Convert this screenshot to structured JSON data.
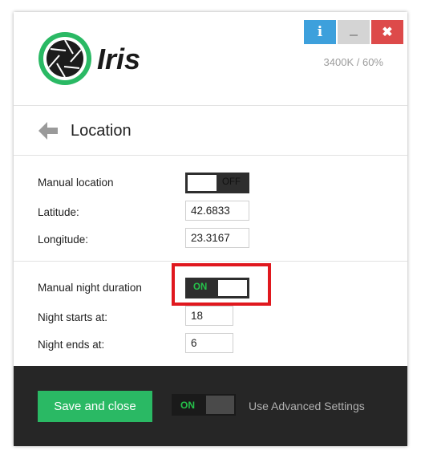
{
  "app": {
    "name": "Iris",
    "status": "3400K / 60%"
  },
  "window_buttons": {
    "info_label": "i",
    "minimize_label": "",
    "close_label": "✖"
  },
  "section": {
    "title": "Location"
  },
  "location": {
    "manual_location_label": "Manual location",
    "manual_location_state": "OFF",
    "latitude_label": "Latitude:",
    "latitude_value": "42.6833",
    "longitude_label": "Longitude:",
    "longitude_value": "23.3167"
  },
  "night": {
    "manual_duration_label": "Manual night duration",
    "manual_duration_state": "ON",
    "starts_label": "Night starts at:",
    "starts_value": "18",
    "ends_label": "Night ends at:",
    "ends_value": "6"
  },
  "footer": {
    "save_label": "Save and close",
    "advanced_state": "ON",
    "advanced_label": "Use Advanced Settings"
  },
  "colors": {
    "accent_green": "#2ab964",
    "toggle_on_text": "#25c24a",
    "info_blue": "#3da0dc",
    "close_red": "#dd4a4a",
    "highlight_red": "#e0181e",
    "footer_bg": "#262626"
  },
  "icons": {
    "logo": "iris-aperture-icon",
    "back": "arrow-left-icon",
    "info": "info-icon",
    "minimize": "minimize-icon",
    "close": "close-icon"
  }
}
